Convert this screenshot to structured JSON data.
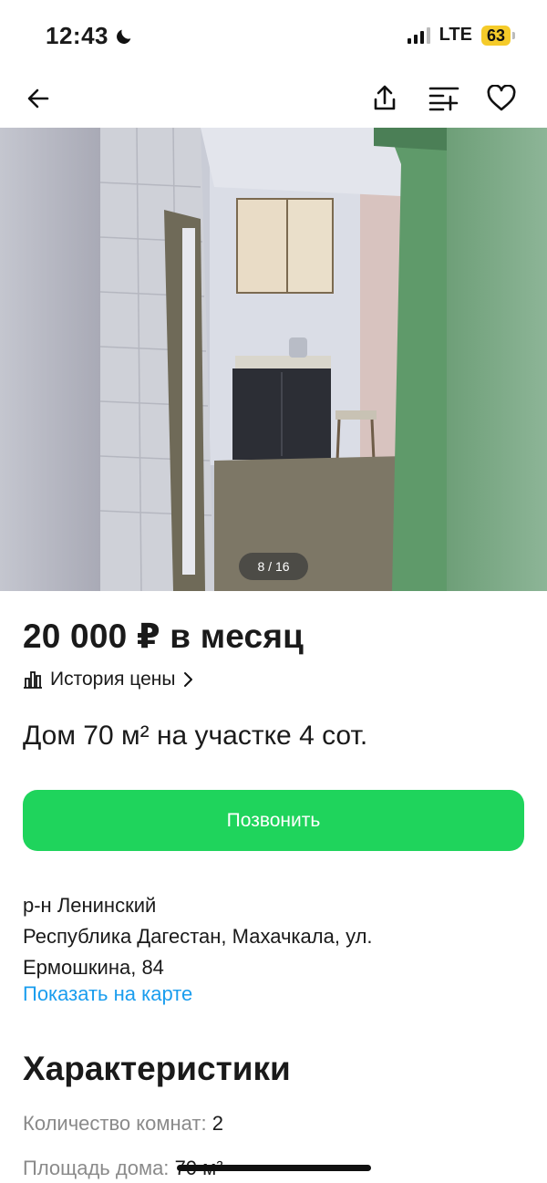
{
  "status_bar": {
    "time": "12:43",
    "network": "LTE",
    "battery": "63",
    "battery_color": "#f5cb2a"
  },
  "toolbar": {
    "back_icon": "arrow-left-icon",
    "share_icon": "share-icon",
    "compare_icon": "compare-list-icon",
    "favorite_icon": "heart-icon"
  },
  "gallery": {
    "counter": "8 / 16",
    "current_index": 8,
    "total": 16
  },
  "listing": {
    "price": "20 000 ₽ в месяц",
    "price_history_label": "История цены",
    "title": "Дом 70 м² на участке 4 сот.",
    "call_button_label": "Позвонить",
    "call_button_color": "#1fd45c",
    "address": {
      "district": "р-н Ленинский",
      "line1": "Республика Дагестан, Махачкала, ул.",
      "line2": "Ермошкина, 84"
    },
    "map_link_label": "Показать на карте",
    "link_color": "#1a9dee"
  },
  "characteristics": {
    "title": "Характеристики",
    "items": [
      {
        "label": "Количество комнат:",
        "value": "2"
      },
      {
        "label": "Площадь дома:",
        "value": "70 м²"
      }
    ]
  }
}
